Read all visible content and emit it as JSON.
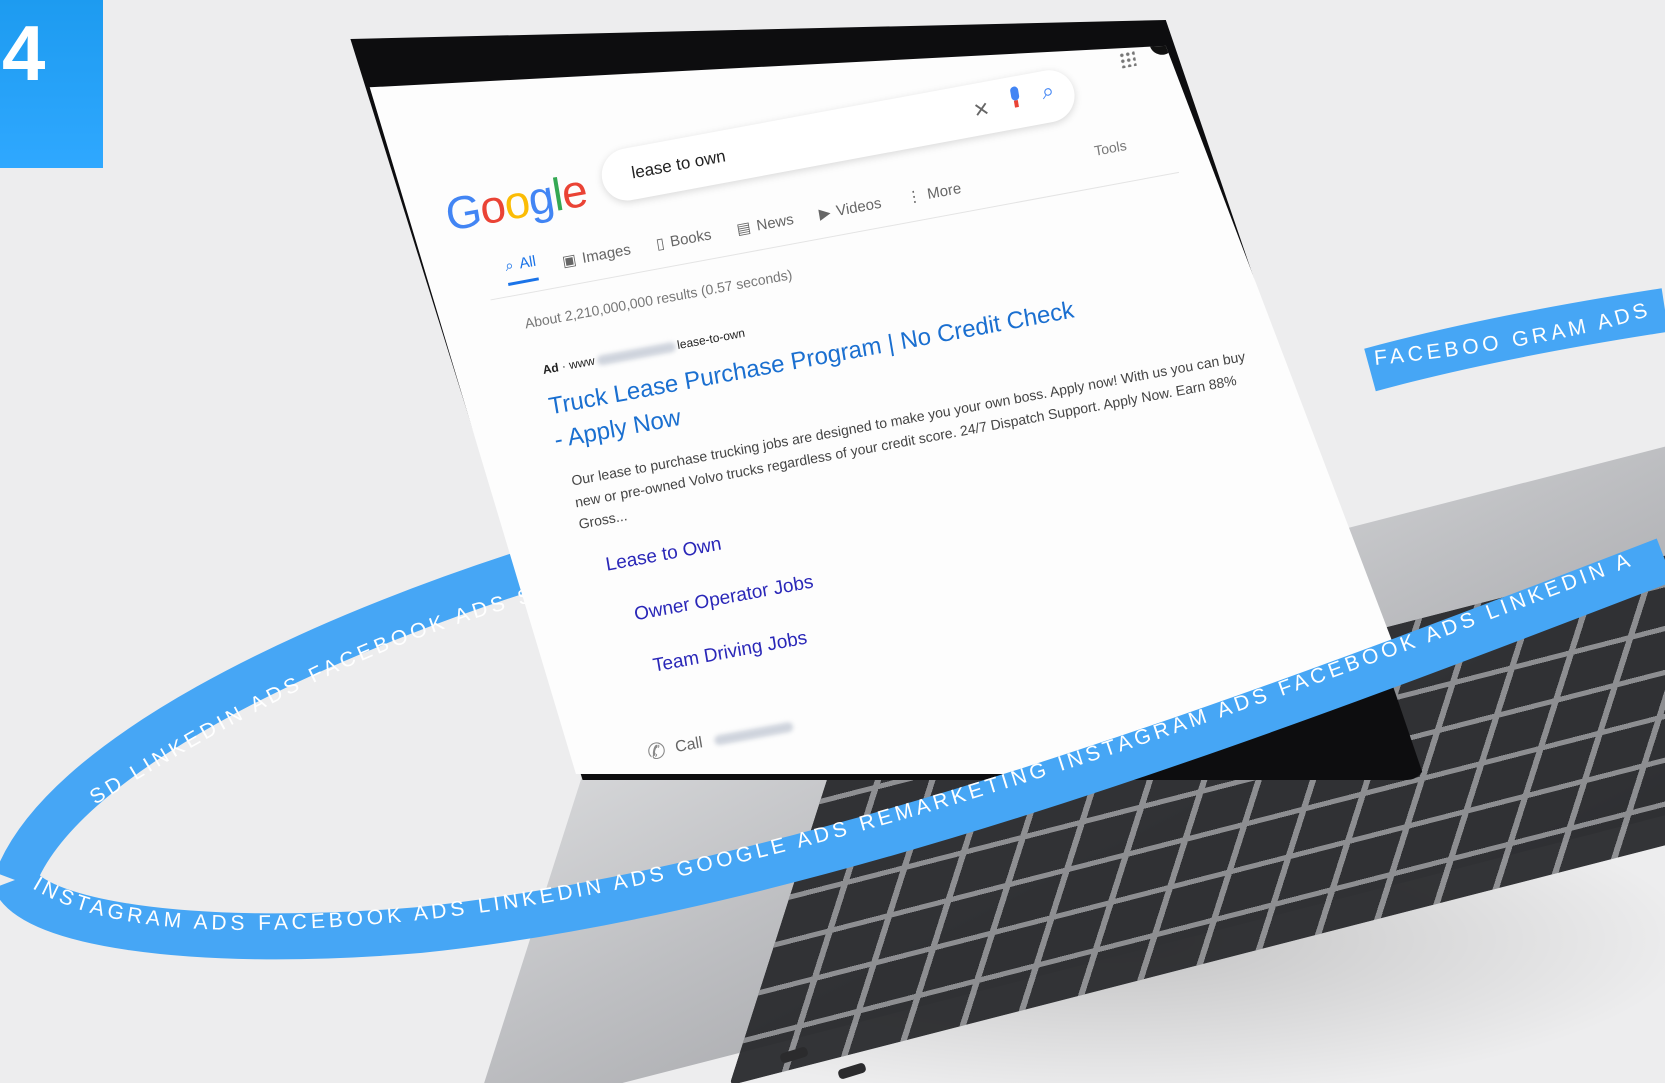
{
  "badge": {
    "number": "4"
  },
  "google": {
    "logo_letters": [
      {
        "ch": "G",
        "color": "#4285f4"
      },
      {
        "ch": "o",
        "color": "#ea4335"
      },
      {
        "ch": "o",
        "color": "#fbbc05"
      },
      {
        "ch": "g",
        "color": "#4285f4"
      },
      {
        "ch": "l",
        "color": "#34a853"
      },
      {
        "ch": "e",
        "color": "#ea4335"
      }
    ],
    "query": "lease to own",
    "tabs": {
      "all": "All",
      "images": "Images",
      "books": "Books",
      "news": "News",
      "videos": "Videos",
      "more": "More"
    },
    "tools": "Tools",
    "stats": "About 2,210,000,000 results (0.57 seconds)",
    "ad": {
      "label": "Ad",
      "url_prefix": "· www",
      "url_suffix": "lease-to-own",
      "title": "Truck Lease Purchase Program | No Credit Check - Apply Now",
      "description": "Our lease to purchase trucking jobs are designed to make you your own boss. Apply now! With us you can buy new or pre-owned Volvo trucks regardless of your credit score. 24/7 Dispatch Support. Apply Now. Earn 88% Gross...",
      "sitelinks": [
        "Lease to Own",
        "Owner Operator Jobs",
        "Team Driving Jobs"
      ],
      "call": "Call"
    }
  },
  "ribbon": {
    "front_text": "INSTAGRAM ADS   FACEBOOK ADS   LINKEDIN ADS   GOOGLE ADS   REMARKETING   INSTAGRAM ADS   FACEBOOK ADS   LINKEDIN A",
    "back_left_text": "SD   LINKEDIN ADS   FACEBOOK ADS   SD",
    "back_right_text": "FACEBOO   GRAM ADS",
    "color": "#46a6f5"
  }
}
